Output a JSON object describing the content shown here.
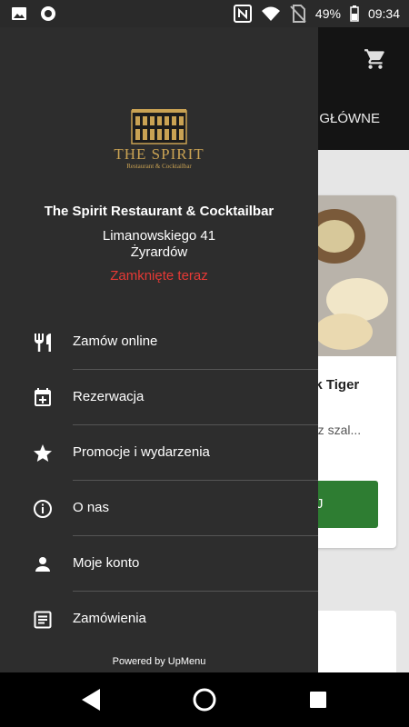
{
  "status_bar": {
    "battery": "49%",
    "time": "09:34"
  },
  "background": {
    "tab_label": "A GŁÓWNE",
    "item_title": "ck Tiger",
    "item_desc": "e z szal...",
    "button_label": "AJ"
  },
  "drawer": {
    "logo_title": "THE SPIRIT",
    "logo_subtitle": "Restaurant & Cocktailbar",
    "restaurant_name": "The Spirit Restaurant & Cocktailbar",
    "address_line1": "Limanowskiego 41",
    "address_line2": "Żyrardów",
    "status": "Zamknięte teraz",
    "status_color": "#e53935",
    "menu": [
      {
        "label": "Zamów online",
        "icon": "cutlery-icon"
      },
      {
        "label": "Rezerwacja",
        "icon": "calendar-add-icon"
      },
      {
        "label": "Promocje i wydarzenia",
        "icon": "star-icon"
      },
      {
        "label": "O nas",
        "icon": "info-icon"
      },
      {
        "label": "Moje konto",
        "icon": "person-icon"
      },
      {
        "label": "Zamówienia",
        "icon": "receipt-icon"
      }
    ],
    "powered_by": "Powered by UpMenu"
  }
}
